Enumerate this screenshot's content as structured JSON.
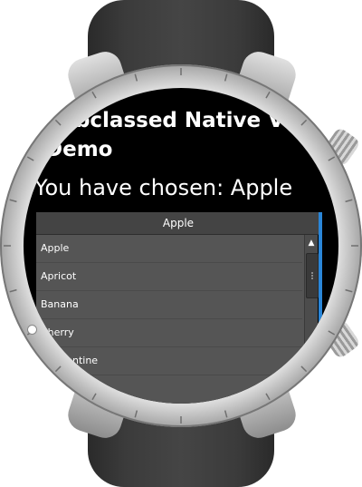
{
  "app": {
    "title": "Subclassed Native View Demo",
    "chosen_label": "You have chosen: Apple"
  },
  "dropdown": {
    "selected": "Apple",
    "items": [
      {
        "label": "Apple"
      },
      {
        "label": "Apricot"
      },
      {
        "label": "Banana"
      },
      {
        "label": "Cherry"
      },
      {
        "label": "Clementine"
      }
    ]
  },
  "icons": {
    "scroll_up": "chevron-up-icon",
    "scroll_thumb": "scroll-grip-icon"
  },
  "colors": {
    "screen_bg": "#000000",
    "list_bg": "#555555",
    "accent": "#2a86d8"
  }
}
